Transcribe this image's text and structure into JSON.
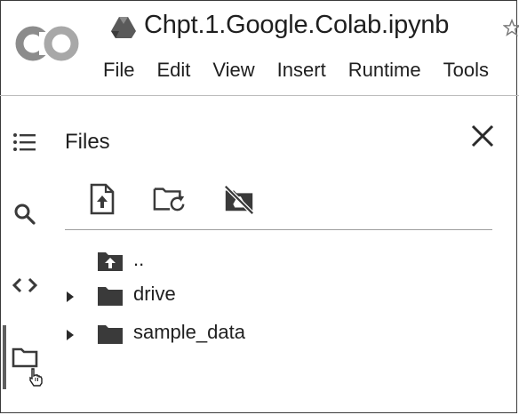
{
  "header": {
    "notebook_title": "Chpt.1.Google.Colab.ipynb",
    "menu": [
      "File",
      "Edit",
      "View",
      "Insert",
      "Runtime",
      "Tools"
    ]
  },
  "rail": {
    "icons": [
      "table-of-contents-icon",
      "search-icon",
      "code-snippets-icon",
      "files-folder-icon"
    ],
    "active": "files-folder-icon"
  },
  "files_panel": {
    "title": "Files",
    "toolbar": [
      "upload-file-icon",
      "refresh-folder-icon",
      "mount-drive-off-icon"
    ],
    "tree": [
      {
        "label": "..",
        "kind": "parent-folder",
        "expandable": false
      },
      {
        "label": "drive",
        "kind": "folder",
        "expandable": true
      },
      {
        "label": "sample_data",
        "kind": "folder",
        "expandable": true
      }
    ]
  }
}
